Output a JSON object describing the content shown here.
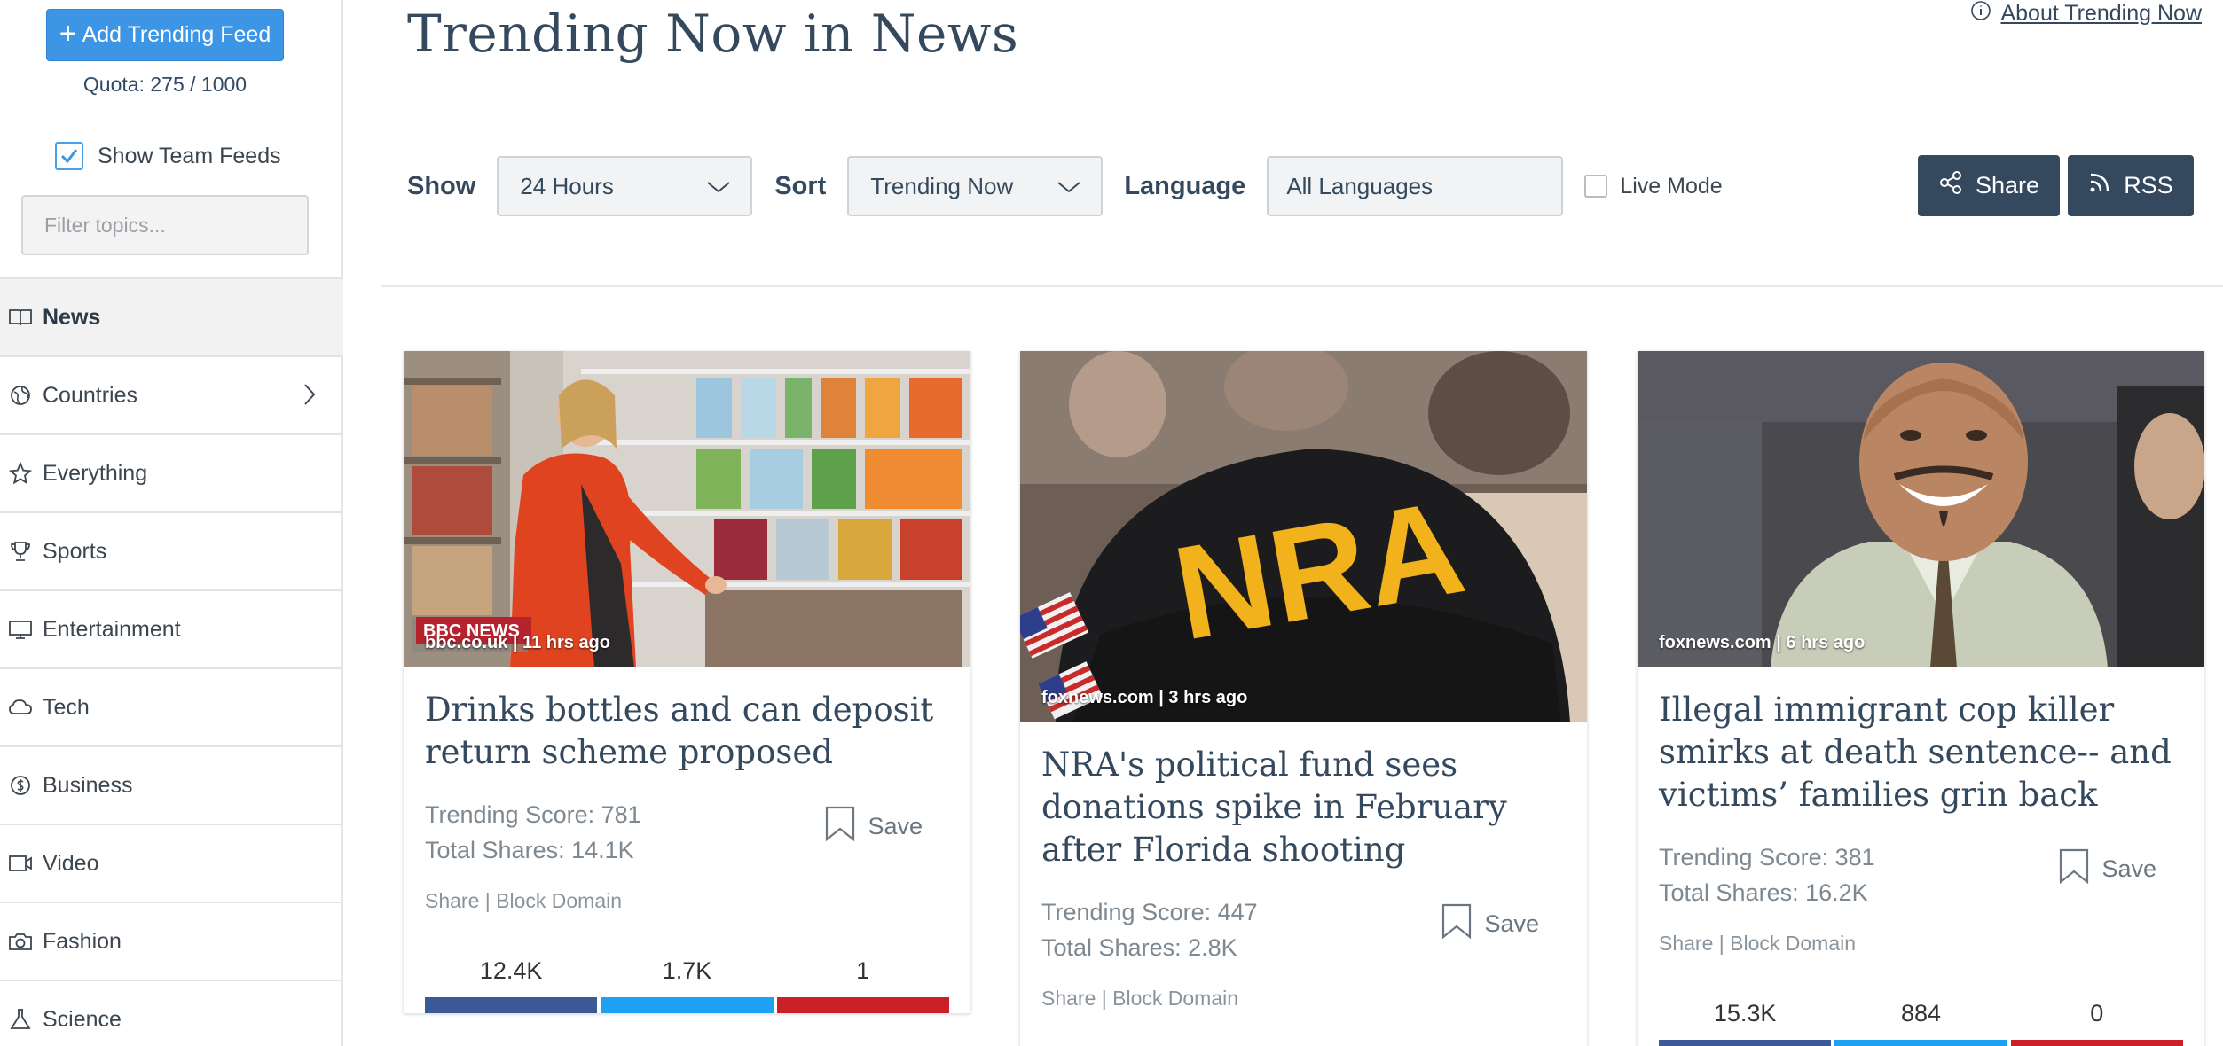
{
  "sidebar": {
    "add_button": "Add Trending Feed",
    "quota": "Quota: 275 / 1000",
    "show_team_feeds": "Show Team Feeds",
    "filter_placeholder": "Filter topics...",
    "items": [
      {
        "label": "News",
        "icon": "book-icon"
      },
      {
        "label": "Countries",
        "icon": "globe-icon"
      },
      {
        "label": "Everything",
        "icon": "star-icon"
      },
      {
        "label": "Sports",
        "icon": "trophy-icon"
      },
      {
        "label": "Entertainment",
        "icon": "monitor-icon"
      },
      {
        "label": "Tech",
        "icon": "cloud-icon"
      },
      {
        "label": "Business",
        "icon": "dollar-icon"
      },
      {
        "label": "Video",
        "icon": "video-icon"
      },
      {
        "label": "Fashion",
        "icon": "camera-icon"
      },
      {
        "label": "Science",
        "icon": "flask-icon"
      }
    ]
  },
  "header": {
    "title": "Trending Now in News",
    "about_link": "About Trending Now"
  },
  "toolbar": {
    "show_label": "Show",
    "show_value": "24 Hours",
    "sort_label": "Sort",
    "sort_value": "Trending Now",
    "language_label": "Language",
    "language_value": "All Languages",
    "live_mode": "Live Mode",
    "share_button": "Share",
    "rss_button": "RSS"
  },
  "cards": [
    {
      "source": "bbc.co.uk | 11 hrs ago",
      "title": "Drinks bottles and can deposit return scheme proposed",
      "score": "Trending Score: 781",
      "shares": "Total Shares: 14.1K",
      "save": "Save",
      "share_link": "Share",
      "separator": "|",
      "block_link": "Block Domain",
      "counts": [
        "12.4K",
        "1.7K",
        "1"
      ],
      "image_caption": "BBC NEWS"
    },
    {
      "source": "foxnews.com | 3 hrs ago",
      "title": "NRA's political fund sees donations spike in February after Florida shooting",
      "score": "Trending Score: 447",
      "shares": "Total Shares: 2.8K",
      "save": "Save",
      "share_link": "Share",
      "separator": "|",
      "block_link": "Block Domain",
      "image_caption": "NRA"
    },
    {
      "source": "foxnews.com | 6 hrs ago",
      "title": "Illegal immigrant cop killer smirks at death sentence-- and victims’ families grin back",
      "score": "Trending Score: 381",
      "shares": "Total Shares: 16.2K",
      "save": "Save",
      "share_link": "Share",
      "separator": "|",
      "block_link": "Block Domain",
      "counts": [
        "15.3K",
        "884",
        "0"
      ]
    }
  ],
  "colors": {
    "facebook": "#3b5998",
    "twitter": "#1da1f2",
    "pinterest": "#cb2027",
    "accent": "#3d95e6",
    "dark": "#34495e"
  }
}
